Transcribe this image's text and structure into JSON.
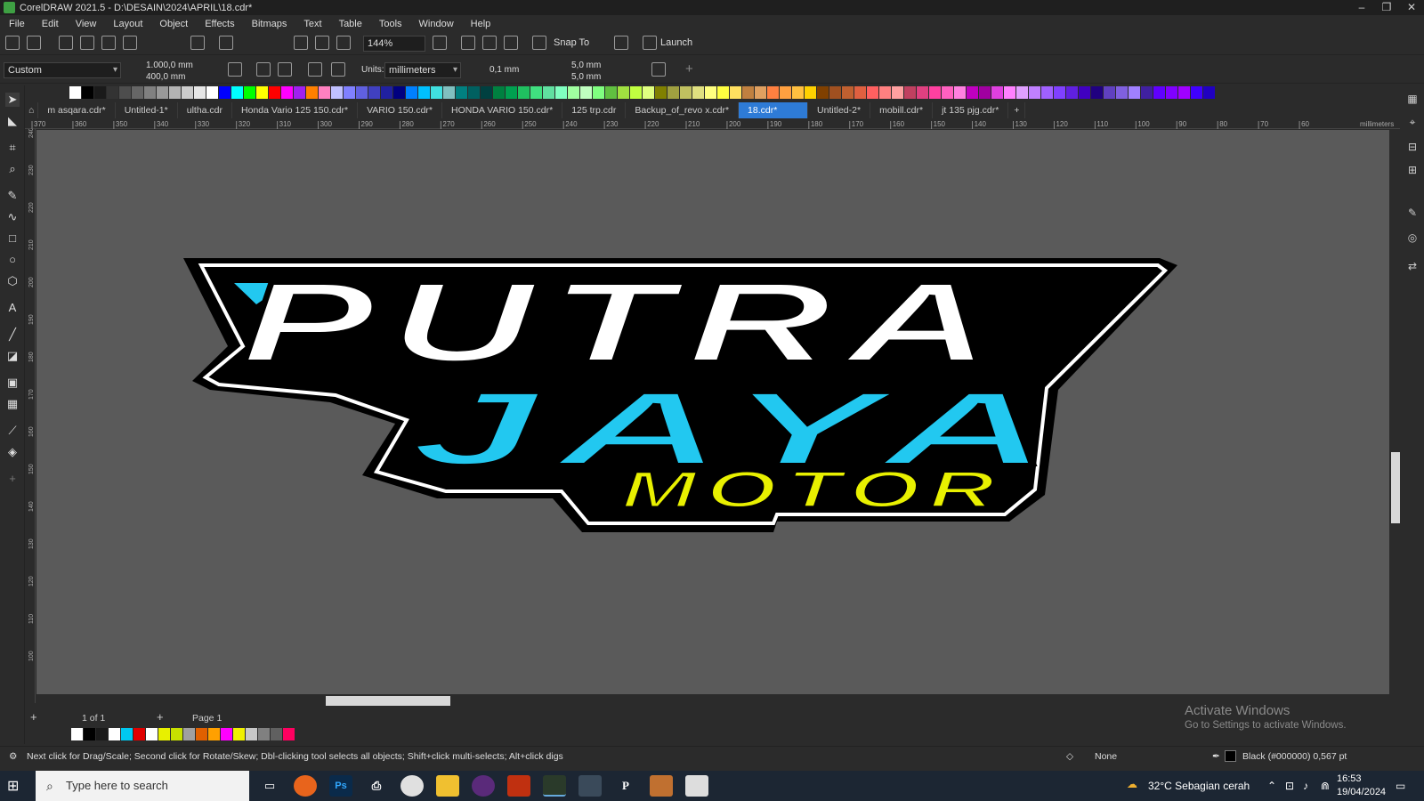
{
  "window": {
    "title": "CorelDRAW 2021.5 - D:\\DESAIN\\2024\\APRIL\\18.cdr*",
    "controls": [
      "–",
      "❐",
      "✕"
    ]
  },
  "menu": [
    "File",
    "Edit",
    "View",
    "Layout",
    "Object",
    "Effects",
    "Bitmaps",
    "Text",
    "Table",
    "Tools",
    "Window",
    "Help"
  ],
  "toolbar": {
    "zoom": "144%",
    "snap_to": "Snap To",
    "launch": "Launch"
  },
  "propbar": {
    "preset": "Custom",
    "width": "1.000,0 mm",
    "height": "400,0 mm",
    "units_label": "Units:",
    "units": "millimeters",
    "nudge": "0,1 mm",
    "dup_x": "5,0 mm",
    "dup_y": "5,0 mm"
  },
  "palette_top": [
    "#ffffff",
    "#000000",
    "#1a1a1a",
    "#333333",
    "#4d4d4d",
    "#666666",
    "#808080",
    "#999999",
    "#b3b3b3",
    "#cccccc",
    "#e6e6e6",
    "#ffffff",
    "#0000ff",
    "#00ffff",
    "#00ff00",
    "#ffff00",
    "#ff0000",
    "#ff00ff",
    "#a020f0",
    "#ff8000",
    "#ff80c0",
    "#c0c0ff",
    "#8080ff",
    "#6060e0",
    "#4040c0",
    "#2020a0",
    "#000080",
    "#0080ff",
    "#00c0ff",
    "#40e0e0",
    "#80c0c0",
    "#008080",
    "#006060",
    "#004040",
    "#008040",
    "#00a050",
    "#20c060",
    "#40e080",
    "#60e0a0",
    "#80ffc0",
    "#a0ffa0",
    "#c0ffc0",
    "#80ff80",
    "#60c040",
    "#a0e040",
    "#c0ff40",
    "#e0ff80",
    "#808000",
    "#a0a040",
    "#c0c060",
    "#e0e080",
    "#ffff80",
    "#ffff40",
    "#ffe060",
    "#c08040",
    "#e0a060",
    "#ff8040",
    "#ffa040",
    "#ffc040",
    "#ffd000",
    "#804000",
    "#a05020",
    "#c06030",
    "#e06040",
    "#ff6060",
    "#ff8080",
    "#ffa0a0",
    "#c04060",
    "#e04080",
    "#ff40a0",
    "#ff60c0",
    "#ff80e0",
    "#c000c0",
    "#a000a0",
    "#e040e0",
    "#ff80ff",
    "#e0a0ff",
    "#c080ff",
    "#a060ff",
    "#8040ff",
    "#6020e0",
    "#4000c0",
    "#200080",
    "#6040c0",
    "#8060e0",
    "#a080ff",
    "#4020a0",
    "#6000ff",
    "#8000ff",
    "#a000ff",
    "#4000ff",
    "#2000c0"
  ],
  "doc_tabs": [
    "m asqara.cdr*",
    "Untitled-1*",
    "ultha.cdr",
    "Honda Vario 125 150.cdr*",
    "VARIO 150.cdr*",
    "HONDA VARIO 150.cdr*",
    "125 trp.cdr",
    "Backup_of_revo x.cdr*",
    "18.cdr*",
    "Untitled-2*",
    "mobill.cdr*",
    "jt 135 pjg.cdr*"
  ],
  "active_tab_index": 8,
  "ruler": {
    "h_labels": [
      "370",
      "360",
      "350",
      "340",
      "330",
      "320",
      "310",
      "300",
      "290",
      "280",
      "270",
      "260",
      "250",
      "240",
      "230",
      "220",
      "210",
      "200",
      "190",
      "180",
      "170",
      "160",
      "150",
      "140",
      "130",
      "120",
      "110",
      "100",
      "90",
      "80",
      "70",
      "60"
    ],
    "unit": "millimeters",
    "v_labels": [
      "240",
      "230",
      "220",
      "210",
      "200",
      "190",
      "180",
      "170",
      "160",
      "150",
      "140",
      "130",
      "120",
      "110",
      "100"
    ]
  },
  "artwork": {
    "line1": "PUTRA",
    "line2": "JAYA",
    "line3": "MOTOR",
    "colors": {
      "line1": "#ffffff",
      "line1_stripe": "#c8c8c8",
      "line2": "#22c8f0",
      "line3": "#e8f000",
      "outline": "#000000"
    }
  },
  "pagebar": {
    "page_count": "1 of 1",
    "page_name": "Page 1"
  },
  "palette_bottom": [
    "#ffffff",
    "#000000",
    "#1a1a1a",
    "#ffffff",
    "#00c8f0",
    "#e00000",
    "#ffffff",
    "#e8f000",
    "#c8e000",
    "#a0a0a0",
    "#e06000",
    "#ffa000",
    "#ff00ff",
    "#f0f000",
    "#c8c8c8",
    "#808080",
    "#606060",
    "#ff0060"
  ],
  "statusbar": {
    "hint": "Next click for Drag/Scale; Second click for Rotate/Skew; Dbl-clicking tool selects all objects; Shift+click multi-selects; Alt+click digs",
    "fill": "None",
    "outline": "Black (#000000)  0,567 pt"
  },
  "watermark": {
    "title": "Activate Windows",
    "subtitle": "Go to Settings to activate Windows."
  },
  "taskbar": {
    "search_placeholder": "Type here to search",
    "weather": "32°C  Sebagian cerah",
    "time": "16:53",
    "date": "19/04/2024"
  }
}
